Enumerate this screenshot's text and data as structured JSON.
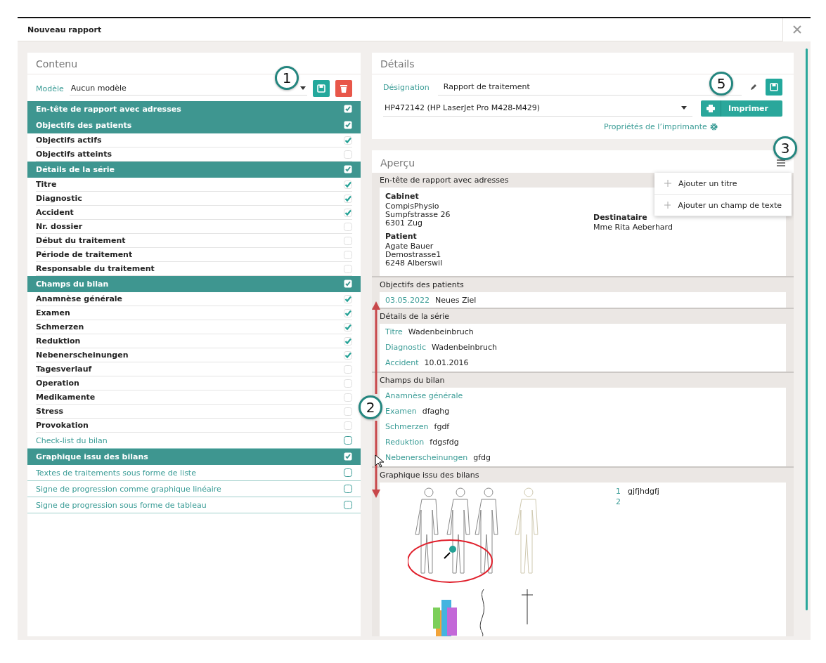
{
  "window": {
    "title": "Nouveau rapport"
  },
  "content": {
    "title": "Contenu",
    "template": {
      "label": "Modèle",
      "value": "Aucun modèle",
      "callout": "1"
    },
    "sections": [
      {
        "label": "En-tête de rapport avec adresses",
        "checked": true
      },
      {
        "label": "Objectifs des patients",
        "checked": true,
        "items": [
          {
            "label": "Objectifs actifs",
            "checked": true
          },
          {
            "label": "Objectifs atteints",
            "checked": false
          }
        ]
      },
      {
        "label": "Détails de la série",
        "checked": true,
        "items": [
          {
            "label": "Titre",
            "checked": true
          },
          {
            "label": "Diagnostic",
            "checked": true
          },
          {
            "label": "Accident",
            "checked": true
          },
          {
            "label": "Nr. dossier",
            "checked": false
          },
          {
            "label": "Début du traitement",
            "checked": false
          },
          {
            "label": "Période de traitement",
            "checked": false
          },
          {
            "label": "Responsable du traitement",
            "checked": false
          }
        ]
      },
      {
        "label": "Champs du bilan",
        "checked": true,
        "items": [
          {
            "label": "Anamnèse générale",
            "checked": true
          },
          {
            "label": "Examen",
            "checked": true
          },
          {
            "label": "Schmerzen",
            "checked": true
          },
          {
            "label": "Reduktion",
            "checked": true
          },
          {
            "label": "Nebenerscheinungen",
            "checked": true
          },
          {
            "label": "Tagesverlauf",
            "checked": false
          },
          {
            "label": "Operation",
            "checked": false
          },
          {
            "label": "Medikamente",
            "checked": false
          },
          {
            "label": "Stress",
            "checked": false
          },
          {
            "label": "Provokation",
            "checked": false
          }
        ]
      },
      {
        "label": "Check-list du bilan",
        "checked": false
      },
      {
        "label": "Graphique issu des bilans",
        "checked": true
      },
      {
        "label": "Textes de traitements sous forme de liste",
        "checked": false
      },
      {
        "label": "Signe de progression comme graphique linéaire",
        "checked": false
      },
      {
        "label": "Signe de progression sous forme de tableau",
        "checked": false
      }
    ]
  },
  "details": {
    "title": "Détails",
    "callout": "5",
    "designation": {
      "label": "Désignation",
      "value": "Rapport de traitement"
    },
    "printer": "HP472142 (HP LaserJet Pro M428-M429)",
    "print_button": "Imprimer",
    "printer_properties": "Propriétés de l’imprimante"
  },
  "preview": {
    "title": "Aperçu",
    "callout": "3",
    "menu": [
      "Ajouter un titre",
      "Ajouter un champ de texte"
    ],
    "sections": [
      {
        "kind": "addresses",
        "title": "En-tête de rapport avec adresses",
        "blocks": [
          {
            "heading": "Cabinet",
            "lines": [
              "CompisPhysio",
              "Sumpfstrasse 26",
              "6301 Zug"
            ]
          },
          {
            "heading": "Patient",
            "lines": [
              "Agate Bauer",
              "Demostrasse1",
              "6248 Alberswil"
            ]
          }
        ],
        "recipient": {
          "heading": "Destinataire",
          "lines": [
            "Mme Rita Aeberhard"
          ]
        }
      },
      {
        "kind": "fields",
        "title": "Objectifs des patients",
        "fields": [
          {
            "label": "03.05.2022",
            "value": "Neues Ziel"
          }
        ]
      },
      {
        "kind": "fields",
        "title": "Détails de la série",
        "fields": [
          {
            "label": "Titre",
            "value": "Wadenbeinbruch"
          },
          {
            "label": "Diagnostic",
            "value": "Wadenbeinbruch"
          },
          {
            "label": "Accident",
            "value": "10.01.2016"
          }
        ]
      },
      {
        "kind": "fields",
        "title": "Champs du bilan",
        "callout": "2",
        "fields": [
          {
            "label": "Anamnèse générale"
          },
          {
            "label": "Examen",
            "value": "dfaghg"
          },
          {
            "label": "Schmerzen",
            "value": "fgdf"
          },
          {
            "label": "Reduktion",
            "value": "fdgsfdg"
          },
          {
            "label": "Nebenerscheinungen",
            "value": "gfdg"
          }
        ]
      },
      {
        "kind": "graphic",
        "title": "Graphique issu des bilans",
        "notes": [
          {
            "number": "1",
            "text": "gjfjhdgfj"
          },
          {
            "number": "2"
          }
        ]
      }
    ]
  }
}
